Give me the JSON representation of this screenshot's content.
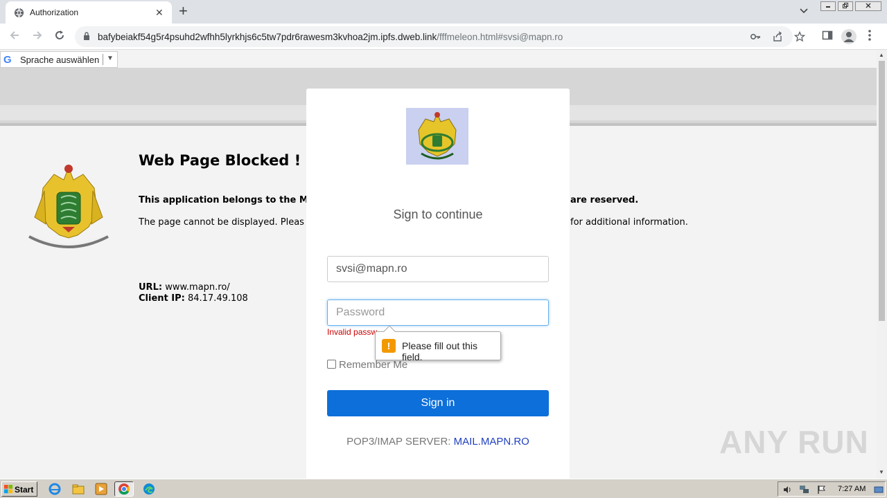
{
  "browser": {
    "tab_title": "Authorization",
    "tab_close": "✕",
    "new_tab": "+",
    "url_main": "bafybeiakf54g5r4psuhd2wfhh5lyrkhjs6c5tw7pdr6rawesm3kvhoa2jm.ipfs.dweb.link",
    "url_rest": "/fffmeleon.html#svsi@mapn.ro"
  },
  "translate": {
    "label": "Sprache auswählen",
    "logo": "G",
    "dropdown": "▼"
  },
  "page": {
    "title": "Web Page Blocked ! !",
    "belongs_left": "This application belongs to the Mi",
    "belongs_right": "are reserved.",
    "cannot_left": "The page cannot be displayed. Pleas",
    "cannot_right": "for additional information.",
    "url_label": "URL:",
    "url_value": "www.mapn.ro/",
    "ip_label": "Client IP:",
    "ip_value": "84.17.49.108"
  },
  "login": {
    "heading": "Sign to continue",
    "email_value": "svsi@mapn.ro",
    "password_placeholder": "Password",
    "error": "Invalid passw",
    "remember_label": "Remember Me",
    "signin_label": "Sign in",
    "server_label": "POP3/IMAP SERVER:",
    "server_link": "MAIL.MAPN.RO"
  },
  "tooltip": {
    "icon": "!",
    "message": "Please fill out this field."
  },
  "watermark": "ANY RUN",
  "taskbar": {
    "start_label": "Start",
    "clock": "7:27 AM"
  },
  "colors": {
    "accent": "#0d6fd9",
    "error": "#cc0000",
    "warning": "#f29900"
  }
}
